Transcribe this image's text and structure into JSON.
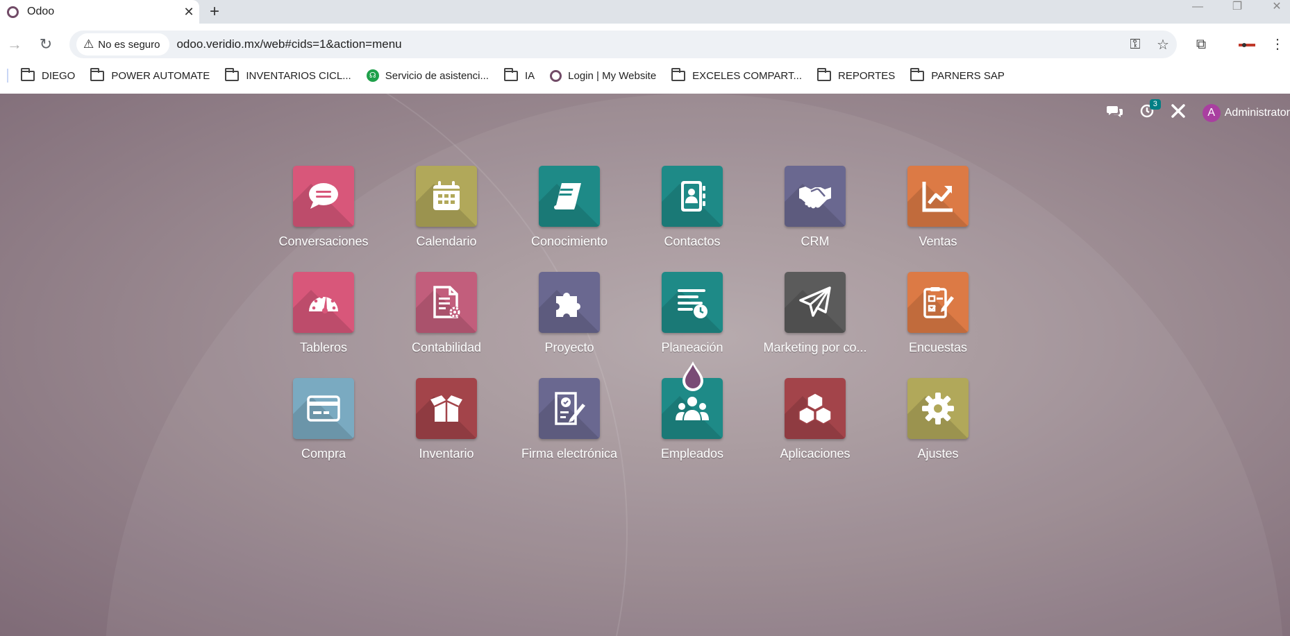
{
  "browser": {
    "tab_title": "Odoo",
    "security_label": "No es seguro",
    "url": "odoo.veridio.mx/web#cids=1&action=menu"
  },
  "bookmarks": [
    {
      "label": "DIEGO",
      "type": "folder"
    },
    {
      "label": "POWER AUTOMATE",
      "type": "folder"
    },
    {
      "label": "INVENTARIOS CICL...",
      "type": "folder"
    },
    {
      "label": "Servicio de asistenci...",
      "type": "green"
    },
    {
      "label": "IA",
      "type": "folder"
    },
    {
      "label": "Login | My Website",
      "type": "odoo"
    },
    {
      "label": "EXCELES COMPART...",
      "type": "folder"
    },
    {
      "label": "REPORTES",
      "type": "folder"
    },
    {
      "label": "PARNERS SAP",
      "type": "folder"
    }
  ],
  "systray": {
    "activity_count": "3",
    "user_initial": "A",
    "user_name": "Administrator"
  },
  "apps": [
    {
      "label": "Conversaciones",
      "icon": "chat-bubble-icon",
      "color": "#d8577a"
    },
    {
      "label": "Calendario",
      "icon": "calendar-icon",
      "color": "#b1a85a"
    },
    {
      "label": "Conocimiento",
      "icon": "book-icon",
      "color": "#1e8a87"
    },
    {
      "label": "Contactos",
      "icon": "address-book-icon",
      "color": "#1e8a87"
    },
    {
      "label": "CRM",
      "icon": "handshake-icon",
      "color": "#6a6890"
    },
    {
      "label": "Ventas",
      "icon": "chart-up-icon",
      "color": "#dc7a45"
    },
    {
      "label": "Tableros",
      "icon": "gauge-icon",
      "color": "#d8577a"
    },
    {
      "label": "Contabilidad",
      "icon": "document-gear-icon",
      "color": "#c25e7c"
    },
    {
      "label": "Proyecto",
      "icon": "puzzle-icon",
      "color": "#6a6890"
    },
    {
      "label": "Planeación",
      "icon": "planning-clock-icon",
      "color": "#1e8a87"
    },
    {
      "label": "Marketing por co...",
      "icon": "paper-plane-icon",
      "color": "#5b5b5b"
    },
    {
      "label": "Encuestas",
      "icon": "checklist-icon",
      "color": "#dc7a45"
    },
    {
      "label": "Compra",
      "icon": "credit-card-icon",
      "color": "#7aaac1"
    },
    {
      "label": "Inventario",
      "icon": "box-icon",
      "color": "#a3444a"
    },
    {
      "label": "Firma electrónica",
      "icon": "signature-icon",
      "color": "#6a6890"
    },
    {
      "label": "Empleados",
      "icon": "people-icon",
      "color": "#1e8a87"
    },
    {
      "label": "Aplicaciones",
      "icon": "cubes-icon",
      "color": "#a3444a"
    },
    {
      "label": "Ajustes",
      "icon": "gear-icon",
      "color": "#b1a85a"
    }
  ]
}
